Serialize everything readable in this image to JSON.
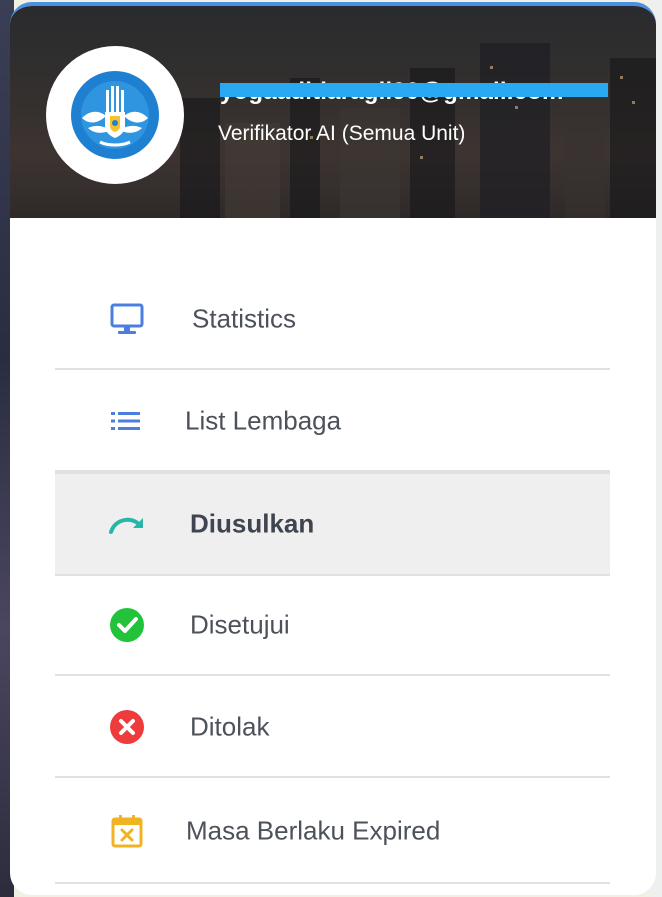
{
  "profile": {
    "email": "yogaaditiaragil90@gmail.com",
    "role": "Verifikator AI (Semua Unit)",
    "avatar_icon": "tut-wuri-handayani-logo"
  },
  "menu": {
    "items": [
      {
        "label": "Statistics",
        "icon": "monitor-icon",
        "color": "#4a7fe0"
      },
      {
        "label": "List Lembaga",
        "icon": "list-icon",
        "color": "#4a7fe0"
      },
      {
        "label": "Diusulkan",
        "icon": "redo-arrow-icon",
        "color": "#26b7a8",
        "active": true
      },
      {
        "label": "Disetujui",
        "icon": "check-circle-icon",
        "color": "#22c33a"
      },
      {
        "label": "Ditolak",
        "icon": "x-circle-icon",
        "color": "#ee3b3b"
      },
      {
        "label": "Masa Berlaku Expired",
        "icon": "calendar-x-icon",
        "color": "#f0b323"
      }
    ]
  },
  "colors": {
    "accent_top_border": "#4a90e2",
    "redaction": "#29a9f2",
    "active_bg": "#efefef"
  }
}
